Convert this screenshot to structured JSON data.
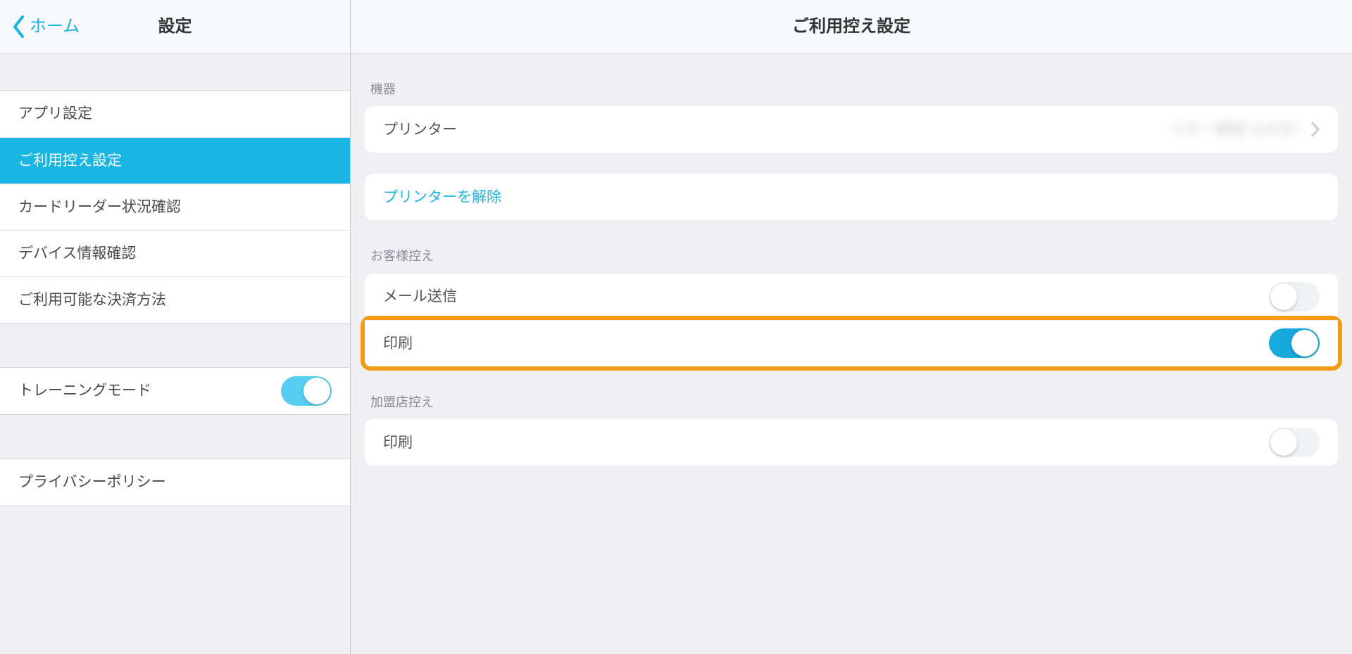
{
  "sidebar": {
    "back_label": "ホーム",
    "title": "設定",
    "nav": [
      {
        "label": "アプリ設定"
      },
      {
        "label": "ご利用控え設定",
        "selected": true
      },
      {
        "label": "カードリーダー状況確認"
      },
      {
        "label": "デバイス情報確認"
      },
      {
        "label": "ご利用可能な決済方法"
      }
    ],
    "training_mode": {
      "label": "トレーニングモード",
      "on": true
    },
    "privacy": {
      "label": "プライバシーポリシー"
    }
  },
  "content": {
    "title": "ご利用控え設定",
    "section_device": "機器",
    "printer": {
      "label": "プリンター"
    },
    "release_printer": {
      "label": "プリンターを解除"
    },
    "section_customer": "お客様控え",
    "mail_send": {
      "label": "メール送信",
      "on": false
    },
    "customer_print": {
      "label": "印刷",
      "on": true
    },
    "section_merchant": "加盟店控え",
    "merchant_print": {
      "label": "印刷",
      "on": false
    }
  }
}
